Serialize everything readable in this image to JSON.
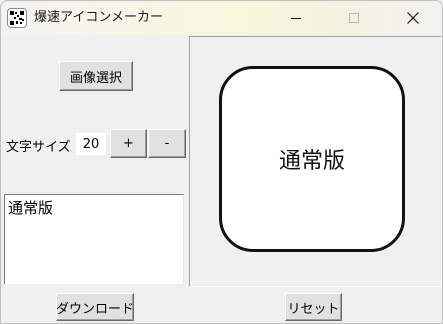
{
  "window": {
    "title": "爆速アイコンメーカー",
    "icons": {
      "app": "qr-app-icon",
      "minimize": "minimize-icon",
      "maximize": "maximize-icon",
      "close": "close-icon"
    }
  },
  "controls": {
    "select_image_label": "画像選択",
    "font_size_label": "文字サイズ",
    "font_size_value": "20",
    "increase_label": "+",
    "decrease_label": "-",
    "text_value": "通常版"
  },
  "preview": {
    "text": "通常版",
    "border_color": "#111111",
    "background": "#ffffff"
  },
  "footer": {
    "download_label": "ダウンロード",
    "reset_label": "リセット"
  }
}
